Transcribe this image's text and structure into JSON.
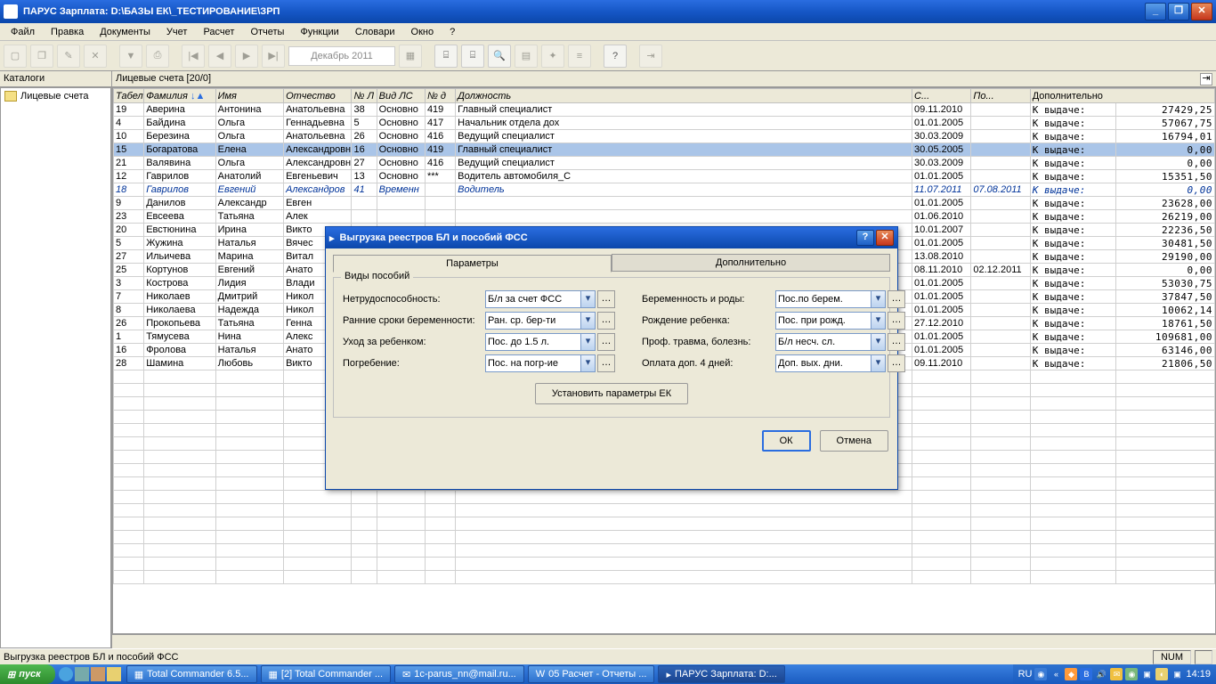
{
  "title": "ПАРУС Зарплата: D:\\БАЗЫ ЕК\\_ТЕСТИРОВАНИЕ\\ЗРП",
  "menu": [
    "Файл",
    "Правка",
    "Документы",
    "Учет",
    "Расчет",
    "Отчеты",
    "Функции",
    "Словари",
    "Окно",
    "?"
  ],
  "period": "Декабрь 2011",
  "panels": {
    "catalogs": "Каталоги",
    "accounts": "Лицевые счета [20/0]",
    "extra": "Дополнительно"
  },
  "tree": {
    "item": "Лицевые счета"
  },
  "columns": [
    "Табель",
    "Фамилия",
    "Имя",
    "Отчество",
    "№ Л",
    "Вид ЛС",
    "№ д",
    "Должность",
    "С...",
    "По...",
    "",
    ""
  ],
  "rows": [
    {
      "t": "19",
      "f": "Аверина",
      "i": "Антонина",
      "o": "Анатольевна",
      "nl": "38",
      "vid": "Основно",
      "nd": "419",
      "dol": "Главный специалист",
      "s": "09.11.2010",
      "po": "",
      "lbl": "К выдаче:",
      "sum": "27429,25"
    },
    {
      "t": "4",
      "f": "Байдина",
      "i": "Ольга",
      "o": "Геннадьевна",
      "nl": "5",
      "vid": "Основно",
      "nd": "417",
      "dol": "Начальник отдела дох",
      "s": "01.01.2005",
      "po": "",
      "lbl": "К выдаче:",
      "sum": "57067,75"
    },
    {
      "t": "10",
      "f": "Березина",
      "i": "Ольга",
      "o": "Анатольевна",
      "nl": "26",
      "vid": "Основно",
      "nd": "416",
      "dol": "Ведущий специалист",
      "s": "30.03.2009",
      "po": "",
      "lbl": "К выдаче:",
      "sum": "16794,01"
    },
    {
      "t": "15",
      "f": "Богаратова",
      "i": "Елена",
      "o": "Александровн",
      "nl": "16",
      "vid": "Основно",
      "nd": "419",
      "dol": "Главный специалист",
      "s": "30.05.2005",
      "po": "",
      "lbl": "К выдаче:",
      "sum": "0,00",
      "sel": true
    },
    {
      "t": "21",
      "f": "Валявина",
      "i": "Ольга",
      "o": "Александровн",
      "nl": "27",
      "vid": "Основно",
      "nd": "416",
      "dol": "Ведущий специалист",
      "s": "30.03.2009",
      "po": "",
      "lbl": "К выдаче:",
      "sum": "0,00"
    },
    {
      "t": "12",
      "f": "Гаврилов",
      "i": "Анатолий",
      "o": "Евгеньевич",
      "nl": "13",
      "vid": "Основно",
      "nd": "***",
      "dol": "Водитель автомобиля_С",
      "s": "01.01.2005",
      "po": "",
      "lbl": "К выдаче:",
      "sum": "15351,50"
    },
    {
      "t": "18",
      "f": "Гаврилов",
      "i": "Евгений",
      "o": "Александров",
      "nl": "41",
      "vid": "Временн",
      "nd": "",
      "dol": "Водитель",
      "s": "11.07.2011",
      "po": "07.08.2011",
      "lbl": "К выдаче:",
      "sum": "0,00",
      "ital": true
    },
    {
      "t": "9",
      "f": "Данилов",
      "i": "Александр",
      "o": "Евген",
      "nl": "",
      "vid": "",
      "nd": "",
      "dol": "",
      "s": "01.01.2005",
      "po": "",
      "lbl": "К выдаче:",
      "sum": "23628,00"
    },
    {
      "t": "23",
      "f": "Евсеева",
      "i": "Татьяна",
      "o": "Алек",
      "nl": "",
      "vid": "",
      "nd": "",
      "dol": "",
      "s": "01.06.2010",
      "po": "",
      "lbl": "К выдаче:",
      "sum": "26219,00"
    },
    {
      "t": "20",
      "f": "Евстюнина",
      "i": "Ирина",
      "o": "Викто",
      "nl": "",
      "vid": "",
      "nd": "",
      "dol": "",
      "s": "10.01.2007",
      "po": "",
      "lbl": "К выдаче:",
      "sum": "22236,50"
    },
    {
      "t": "5",
      "f": "Жужина",
      "i": "Наталья",
      "o": "Вячес",
      "nl": "",
      "vid": "",
      "nd": "",
      "dol": "",
      "s": "01.01.2005",
      "po": "",
      "lbl": "К выдаче:",
      "sum": "30481,50"
    },
    {
      "t": "27",
      "f": "Ильичева",
      "i": "Марина",
      "o": "Витал",
      "nl": "",
      "vid": "",
      "nd": "",
      "dol": "",
      "s": "13.08.2010",
      "po": "",
      "lbl": "К выдаче:",
      "sum": "29190,00"
    },
    {
      "t": "25",
      "f": "Кортунов",
      "i": "Евгений",
      "o": "Анато",
      "nl": "",
      "vid": "",
      "nd": "",
      "dol": "",
      "s": "08.11.2010",
      "po": "02.12.2011",
      "lbl": "К выдаче:",
      "sum": "0,00"
    },
    {
      "t": "3",
      "f": "Кострова",
      "i": "Лидия",
      "o": "Влади",
      "nl": "",
      "vid": "",
      "nd": "",
      "dol": "",
      "s": "01.01.2005",
      "po": "",
      "lbl": "К выдаче:",
      "sum": "53030,75"
    },
    {
      "t": "7",
      "f": "Николаев",
      "i": "Дмитрий",
      "o": "Никол",
      "nl": "",
      "vid": "",
      "nd": "",
      "dol": "",
      "s": "01.01.2005",
      "po": "",
      "lbl": "К выдаче:",
      "sum": "37847,50"
    },
    {
      "t": "8",
      "f": "Николаева",
      "i": "Надежда",
      "o": "Никол",
      "nl": "",
      "vid": "",
      "nd": "",
      "dol": "",
      "s": "01.01.2005",
      "po": "",
      "lbl": "К выдаче:",
      "sum": "10062,14"
    },
    {
      "t": "26",
      "f": "Прокопьева",
      "i": "Татьяна",
      "o": "Генна",
      "nl": "",
      "vid": "",
      "nd": "",
      "dol": "",
      "s": "27.12.2010",
      "po": "",
      "lbl": "К выдаче:",
      "sum": "18761,50"
    },
    {
      "t": "1",
      "f": "Тямусева",
      "i": "Нина",
      "o": "Алекс",
      "nl": "",
      "vid": "",
      "nd": "",
      "dol": "",
      "s": "01.01.2005",
      "po": "",
      "lbl": "К выдаче:",
      "sum": "109681,00"
    },
    {
      "t": "16",
      "f": "Фролова",
      "i": "Наталья",
      "o": "Анато",
      "nl": "",
      "vid": "",
      "nd": "",
      "dol": "",
      "s": "01.01.2005",
      "po": "",
      "lbl": "К выдаче:",
      "sum": "63146,00"
    },
    {
      "t": "28",
      "f": "Шамина",
      "i": "Любовь",
      "o": "Викто",
      "nl": "",
      "vid": "",
      "nd": "",
      "dol": "",
      "s": "09.11.2010",
      "po": "",
      "lbl": "К выдаче:",
      "sum": "21806,50"
    }
  ],
  "status": {
    "text": "Выгрузка реестров БЛ и пособий ФСС",
    "num": "NUM"
  },
  "dialog": {
    "title": "Выгрузка реестров БЛ и пособий ФСС",
    "tabs": [
      "Параметры",
      "Дополнительно"
    ],
    "group": "Виды пособий",
    "left_labels": [
      "Нетрудоспособность:",
      "Ранние сроки беременности:",
      "Уход за ребенком:",
      "Погребение:"
    ],
    "right_labels": [
      "Беременность и роды:",
      "Рождение ребенка:",
      "Проф. травма, болезнь:",
      "Оплата доп. 4 дней:"
    ],
    "left_values": [
      "Б/л за счет ФСС",
      "Ран. ср. бер-ти",
      "Пос. до 1.5 л.",
      "Пос. на погр-ие"
    ],
    "right_values": [
      "Пос.по берем.",
      "Пос. при рожд.",
      "Б/л несч. сл.",
      "Доп. вых. дни."
    ],
    "set_btn": "Установить параметры ЕК",
    "ok": "ОК",
    "cancel": "Отмена"
  },
  "taskbar": {
    "start": "пуск",
    "items": [
      "Total Commander 6.5...",
      "[2] Total Commander ...",
      "1c-parus_nn@mail.ru...",
      "05 Расчет - Отчеты ...",
      "ПАРУС Зарплата: D:..."
    ],
    "lang": "RU",
    "time": "14:19"
  }
}
